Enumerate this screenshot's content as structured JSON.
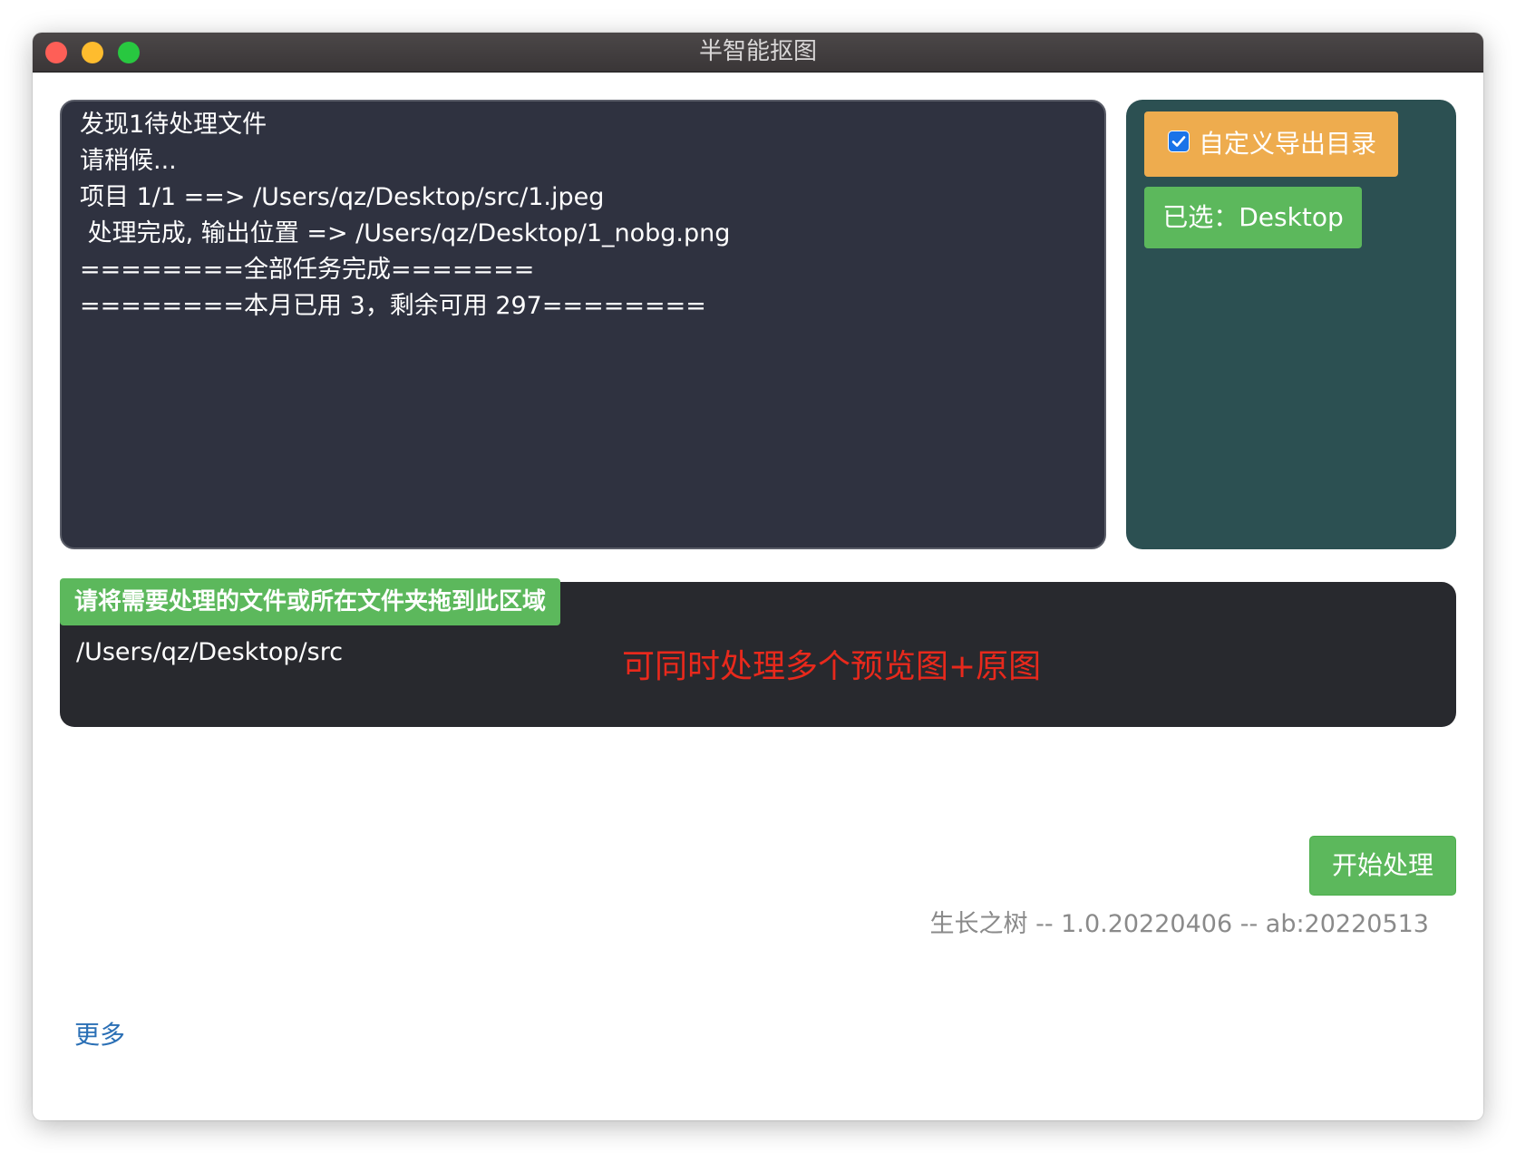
{
  "window": {
    "title": "半智能抠图"
  },
  "log": {
    "lines": [
      "发现1待处理文件",
      "请稍候...",
      "项目 1/1 ==> /Users/qz/Desktop/src/1.jpeg",
      " 处理完成, 输出位置 => /Users/qz/Desktop/1_nobg.png",
      "========全部任务完成=======",
      "========本月已用 3，剩余可用 297========"
    ]
  },
  "side": {
    "custom_export_label": "自定义导出目录",
    "custom_export_checked": true,
    "selected_dir_label": "已选：Desktop"
  },
  "drop_zone": {
    "hint": "请将需要处理的文件或所在文件夹拖到此区域",
    "path": "/Users/qz/Desktop/src",
    "note": "可同时处理多个预览图+原图"
  },
  "actions": {
    "start_label": "开始处理"
  },
  "footer": {
    "version": "生长之树 -- 1.0.20220406 -- ab:20220513",
    "more_label": "更多"
  },
  "colors": {
    "log_bg": "#2f3240",
    "side_bg": "#2c5052",
    "toggle_bg": "#eeac4e",
    "green": "#5cb85c",
    "drop_bg": "#28292e",
    "note_red": "#e8291c",
    "link_blue": "#2a6fb5"
  }
}
